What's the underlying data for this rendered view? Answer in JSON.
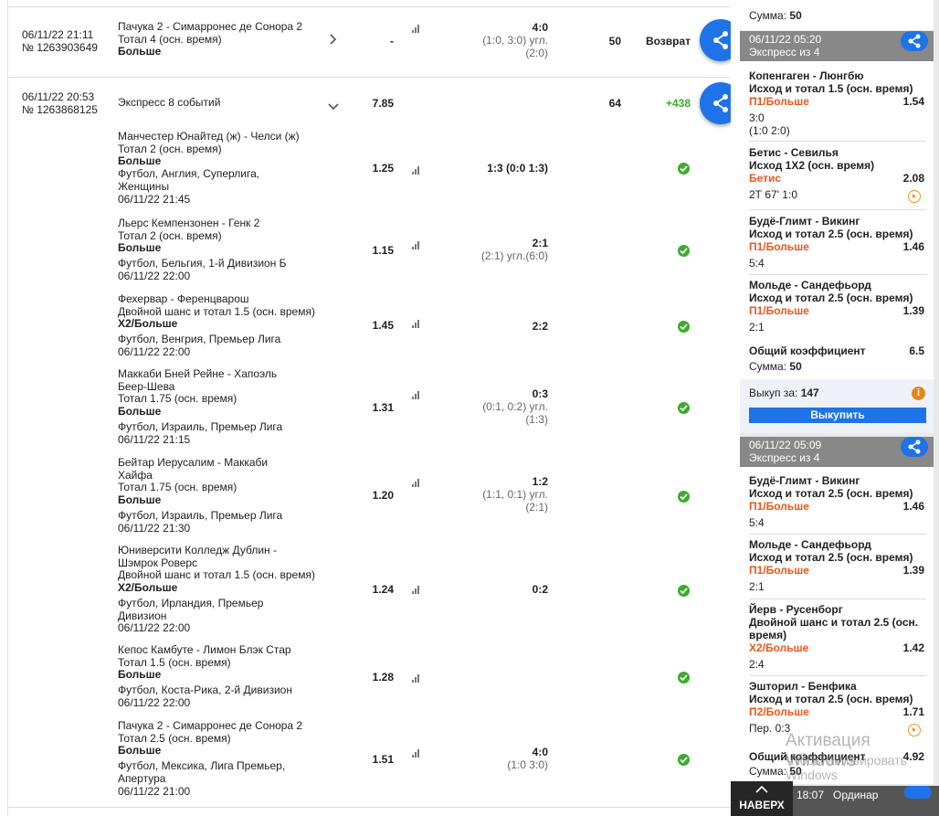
{
  "bet1": {
    "datetime": "06/11/22 21:11",
    "number": "№ 1263903649",
    "event": "Пачука 2 - Симарронес де Сонора 2",
    "market": "Тотал 4 (осн. время)",
    "selection": "Больше",
    "coef": "-",
    "score": "4:0",
    "score_detail1": "(1:0, 3:0) угл.",
    "score_detail2": "(2:0)",
    "sum": "50",
    "result": "Возврат"
  },
  "bet2": {
    "datetime": "06/11/22 20:53",
    "number": "№ 1263868125",
    "title": "Экспресс 8 событий",
    "coef": "7.85",
    "sum": "64",
    "result": "+438"
  },
  "events": [
    {
      "l1": "Манчестер Юнайтед (ж) - Челси (ж)",
      "l2": "Тотал 2 (осн. время)",
      "sel": "Больше",
      "info1": "Футбол, Англия, Суперлига,",
      "info2": "Женщины",
      "date": "06/11/22 21:45",
      "coef": "1.25",
      "score": "1:3 (0:0 1:3)",
      "d1": "",
      "d2": ""
    },
    {
      "l1": "Льерс Кемпензонен - Генк 2",
      "l2": "Тотал 2 (осн. время)",
      "sel": "Больше",
      "info1": "Футбол, Бельгия, 1-й Дивизион Б",
      "info2": "",
      "date": "06/11/22 22:00",
      "coef": "1.15",
      "score": "2:1",
      "d1": "(2:1) угл.(6:0)",
      "d2": ""
    },
    {
      "l1": "Фехервар - Ференцварош",
      "l2": "Двойной шанс и тотал 1.5 (осн. время)",
      "sel": "Х2/Больше",
      "info1": "Футбол, Венгрия, Премьер Лига",
      "info2": "",
      "date": "06/11/22 22:00",
      "coef": "1.45",
      "score": "2:2",
      "d1": "",
      "d2": ""
    },
    {
      "l1": "Маккаби Бней Рейне - Хапоэль",
      "l1b": "Беер-Шева",
      "l2": "Тотал 1.75 (осн. время)",
      "sel": "Больше",
      "info1": "Футбол, Израиль, Премьер Лига",
      "info2": "",
      "date": "06/11/22 21:15",
      "coef": "1.31",
      "score": "0:3",
      "d1": "(0:1, 0:2) угл.",
      "d2": "(1:3)"
    },
    {
      "l1": "Бейтар Иерусалим - Маккаби",
      "l1b": "Хайфа",
      "l2": "Тотал 1.75 (осн. время)",
      "sel": "Больше",
      "info1": "Футбол, Израиль, Премьер Лига",
      "info2": "",
      "date": "06/11/22 21:30",
      "coef": "1.20",
      "score": "1:2",
      "d1": "(1:1, 0:1) угл.",
      "d2": "(2:1)"
    },
    {
      "l1": "Юниверсити Колледж Дублин -",
      "l1b": "Шэмрок Роверс",
      "l2": "Двойной шанс и тотал 1.5 (осн. время)",
      "sel": "Х2/Больше",
      "info1": "Футбол, Ирландия, Премьер",
      "info2": "Дивизион",
      "date": "06/11/22 22:00",
      "coef": "1.24",
      "score": "0:2",
      "d1": "",
      "d2": ""
    },
    {
      "l1": "Кепос Камбуте - Лимон Блэк Стар",
      "l2": "Тотал 1.5 (осн. время)",
      "sel": "Больше",
      "info1": "Футбол, Коста-Рика, 2-й Дивизион",
      "info2": "",
      "date": "06/11/22 22:00",
      "coef": "1.28",
      "score": "",
      "d1": "",
      "d2": ""
    },
    {
      "l1": "Пачука 2 - Симарронес де Сонора 2",
      "l2": "Тотал 2.5 (осн. время)",
      "sel": "Больше",
      "info1": "Футбол, Мексика, Лига Премьер,",
      "info2": "Апертура",
      "date": "06/11/22 21:00",
      "coef": "1.51",
      "score": "4:0",
      "d1": "(1:0 3:0)",
      "d2": ""
    }
  ],
  "side": {
    "top_sum_label": "Сумма:",
    "top_sum": "50",
    "c1": {
      "date": "06/11/22 05:20",
      "title": "Экспресс из 4",
      "items": [
        {
          "match": "Копенгаген - Люнгбю",
          "market": "Исход и тотал 1.5 (осн. время)",
          "pick": "П1/Больше",
          "coef": "1.54",
          "score": "3:0",
          "score2": "(1:0 2:0)"
        },
        {
          "match": "Бетис - Севилья",
          "market": "Исход 1Х2 (осн. время)",
          "pick": "Бетис",
          "coef": "2.08",
          "score": "2Т 67' 1:0",
          "score2": ""
        },
        {
          "match": "Будё-Глимт - Викинг",
          "market": "Исход и тотал 2.5 (осн. время)",
          "pick": "П1/Больше",
          "coef": "1.46",
          "score": "5:4",
          "score2": ""
        },
        {
          "match": "Мольде - Сандефьорд",
          "market": "Исход и тотал 2.5 (осн. время)",
          "pick": "П1/Больше",
          "coef": "1.39",
          "score": "2:1",
          "score2": ""
        }
      ],
      "total_label": "Общий коэффициент",
      "total": "6.5",
      "sum_label": "Сумма:",
      "sum": "50",
      "cashout_label": "Выкуп за:",
      "cashout": "147",
      "button": "Выкупить"
    },
    "c2": {
      "date": "06/11/22 05:09",
      "title": "Экспресс из 4",
      "items": [
        {
          "match": "Будё-Глимт - Викинг",
          "market": "Исход и тотал 2.5 (осн. время)",
          "pick": "П1/Больше",
          "coef": "1.46",
          "score": "5:4"
        },
        {
          "match": "Мольде - Сандефьорд",
          "market": "Исход и тотал 2.5 (осн. время)",
          "pick": "П1/Больше",
          "coef": "1.39",
          "score": "2:1"
        },
        {
          "match": "Йерв - Русенборг",
          "market": "Двойной шанс и тотал 2.5 (осн.",
          "market2": "время)",
          "pick": "Х2/Больше",
          "coef": "1.42",
          "score": "2:4"
        },
        {
          "match": "Эшторил - Бенфика",
          "market": "Исход и тотал 2.5 (осн. время)",
          "pick": "П2/Больше",
          "coef": "1.71",
          "score": "Пер. 0:3"
        }
      ],
      "total_label": "Общий коэффициент",
      "total": "4.92",
      "sum_label": "Сумма:",
      "sum": "50"
    },
    "c3": {
      "time": "18:07",
      "title": "Ординар"
    }
  },
  "to_top": "НАВЕРХ",
  "watermark1": "Активация Windows",
  "watermark2": "Чтобы активировать Windows"
}
